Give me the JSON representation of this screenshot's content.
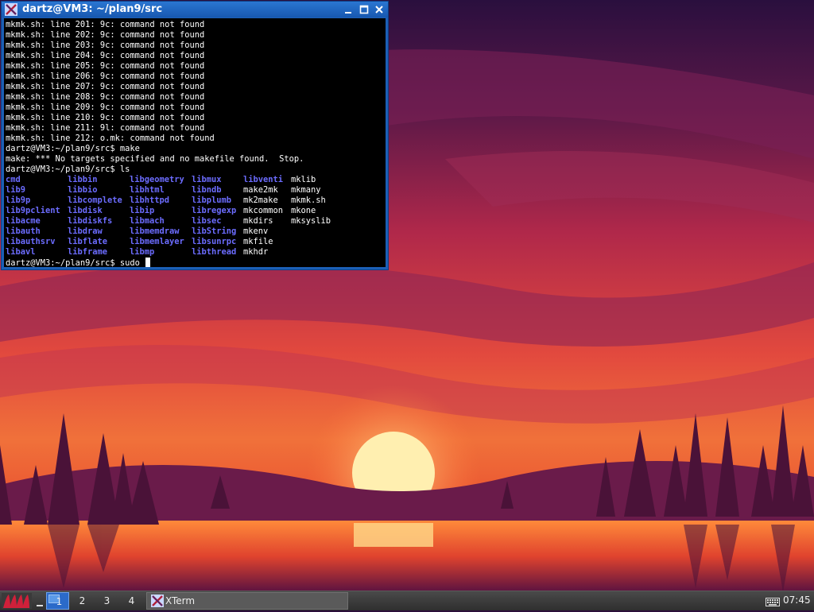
{
  "window": {
    "title": "dartz@VM3: ~/plan9/src"
  },
  "terminal": {
    "lines_before_ls": [
      "mkmk.sh: line 201: 9c: command not found",
      "mkmk.sh: line 202: 9c: command not found",
      "mkmk.sh: line 203: 9c: command not found",
      "mkmk.sh: line 204: 9c: command not found",
      "mkmk.sh: line 205: 9c: command not found",
      "mkmk.sh: line 206: 9c: command not found",
      "mkmk.sh: line 207: 9c: command not found",
      "mkmk.sh: line 208: 9c: command not found",
      "mkmk.sh: line 209: 9c: command not found",
      "mkmk.sh: line 210: 9c: command not found",
      "mkmk.sh: line 211: 9l: command not found",
      "mkmk.sh: line 212: o.mk: command not found",
      "dartz@VM3:~/plan9/src$ make",
      "make: *** No targets specified and no makefile found.  Stop.",
      "dartz@VM3:~/plan9/src$ ls"
    ],
    "ls_rows": [
      [
        [
          "cmd",
          "dir"
        ],
        [
          "libbin",
          "dir"
        ],
        [
          "libgeometry",
          "dir"
        ],
        [
          "libmux",
          "dir"
        ],
        [
          "libventi",
          "dir"
        ],
        [
          "mklib",
          "file"
        ]
      ],
      [
        [
          "lib9",
          "dir"
        ],
        [
          "libbio",
          "dir"
        ],
        [
          "libhtml",
          "dir"
        ],
        [
          "libndb",
          "dir"
        ],
        [
          "make2mk",
          "file"
        ],
        [
          "mkmany",
          "file"
        ]
      ],
      [
        [
          "lib9p",
          "dir"
        ],
        [
          "libcomplete",
          "dir"
        ],
        [
          "libhttpd",
          "dir"
        ],
        [
          "libplumb",
          "dir"
        ],
        [
          "mk2make",
          "file"
        ],
        [
          "mkmk.sh",
          "file"
        ]
      ],
      [
        [
          "lib9pclient",
          "dir"
        ],
        [
          "libdisk",
          "dir"
        ],
        [
          "libip",
          "dir"
        ],
        [
          "libregexp",
          "dir"
        ],
        [
          "mkcommon",
          "file"
        ],
        [
          "mkone",
          "file"
        ]
      ],
      [
        [
          "libacme",
          "dir"
        ],
        [
          "libdiskfs",
          "dir"
        ],
        [
          "libmach",
          "dir"
        ],
        [
          "libsec",
          "dir"
        ],
        [
          "mkdirs",
          "file"
        ],
        [
          "mksyslib",
          "file"
        ]
      ],
      [
        [
          "libauth",
          "dir"
        ],
        [
          "libdraw",
          "dir"
        ],
        [
          "libmemdraw",
          "dir"
        ],
        [
          "libString",
          "dir"
        ],
        [
          "mkenv",
          "file"
        ],
        [
          "",
          ""
        ]
      ],
      [
        [
          "libauthsrv",
          "dir"
        ],
        [
          "libflate",
          "dir"
        ],
        [
          "libmemlayer",
          "dir"
        ],
        [
          "libsunrpc",
          "dir"
        ],
        [
          "mkfile",
          "file"
        ],
        [
          "",
          ""
        ]
      ],
      [
        [
          "libavl",
          "dir"
        ],
        [
          "libframe",
          "dir"
        ],
        [
          "libmp",
          "dir"
        ],
        [
          "libthread",
          "dir"
        ],
        [
          "mkhdr",
          "file"
        ],
        [
          "",
          ""
        ]
      ]
    ],
    "prompt_current": "dartz@VM3:~/plan9/src$ sudo "
  },
  "taskbar": {
    "workspaces": [
      "1",
      "2",
      "3",
      "4"
    ],
    "active_workspace": "1",
    "task_label": "XTerm",
    "clock": "07:45"
  },
  "icons": {
    "app": "xterm-x-icon",
    "menu": "start-menu-icon",
    "keyboard": "keyboard-icon"
  },
  "colors": {
    "titlebar": "#1c5fb6",
    "ls_dir": "#6c6cff",
    "taskbar": "#3a3a3a",
    "active_workspace": "#2b6ac9"
  }
}
